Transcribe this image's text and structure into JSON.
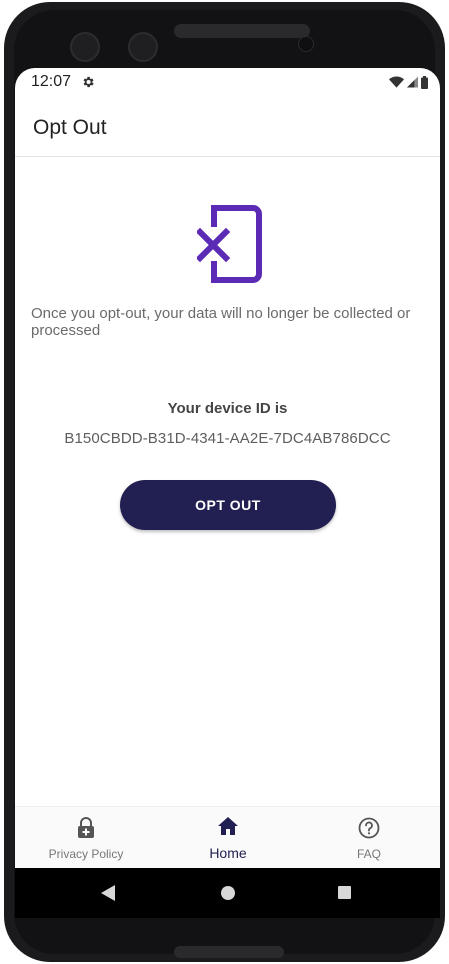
{
  "status_bar": {
    "time": "12:07",
    "icons": [
      "settings-gear-icon",
      "wifi-icon",
      "signal-icon",
      "battery-icon"
    ]
  },
  "app_bar": {
    "title": "Opt Out"
  },
  "main": {
    "illustration": "phone-with-x-icon",
    "message": "Once you opt-out, your data will no longer be collected or processed",
    "device_id_label": "Your device ID is",
    "device_id": "B150CBDD-B31D-4341-AA2E-7DC4AB786DCC",
    "opt_out_button": "OPT OUT"
  },
  "bottom_nav": {
    "items": [
      {
        "label": "Privacy Policy",
        "icon": "lock-plus-icon",
        "selected": false
      },
      {
        "label": "Home",
        "icon": "home-icon",
        "selected": true
      },
      {
        "label": "FAQ",
        "icon": "help-circle-icon",
        "selected": false
      }
    ]
  },
  "colors": {
    "accent_purple": "#5b2bb5",
    "button_navy": "#222052",
    "text_gray": "#6b6b6b"
  }
}
